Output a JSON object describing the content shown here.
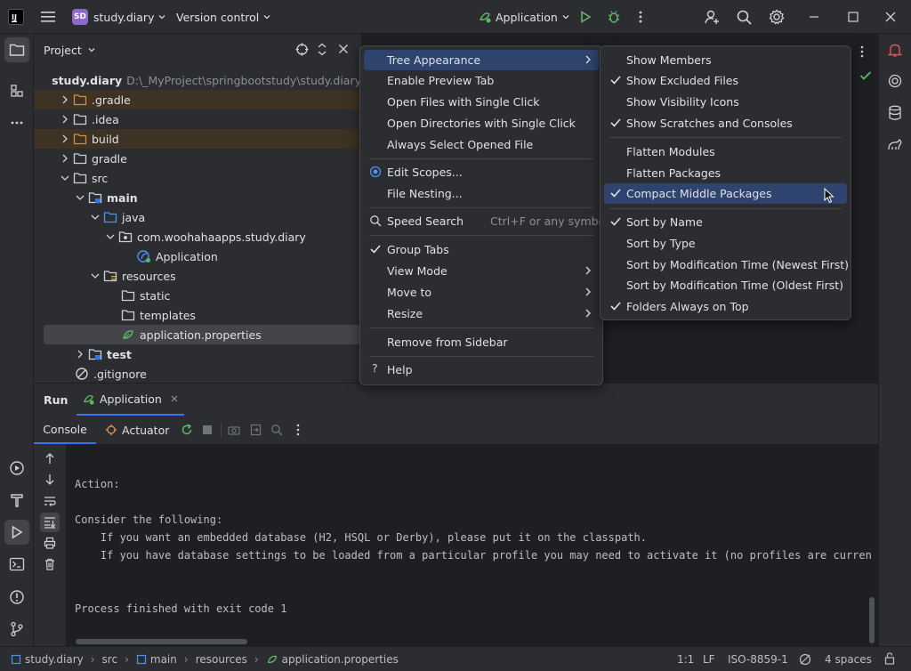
{
  "titlebar": {
    "project_badge": "SD",
    "project_name": "study.diary",
    "vcs_label": "Version control",
    "run_config": "Application",
    "icons": [
      "app-logo-icon",
      "hamburger-icon",
      "run-config-icon",
      "run-icon",
      "debug-icon",
      "more-icon",
      "add-user-icon",
      "search-icon",
      "settings-icon",
      "minimize-icon",
      "maximize-icon",
      "close-icon"
    ]
  },
  "project_panel": {
    "title": "Project",
    "tree": [
      {
        "label": "study.diary",
        "path": "D:\\_MyProject\\springbootstudy\\study.diary"
      },
      {
        "label": ".gradle"
      },
      {
        "label": ".idea"
      },
      {
        "label": "build"
      },
      {
        "label": "gradle"
      },
      {
        "label": "src"
      },
      {
        "label": "main"
      },
      {
        "label": "java"
      },
      {
        "label": "com.woohahaapps.study.diary"
      },
      {
        "label": "Application"
      },
      {
        "label": "resources"
      },
      {
        "label": "static"
      },
      {
        "label": "templates"
      },
      {
        "label": "application.properties"
      },
      {
        "label": "test"
      },
      {
        "label": ".gitignore"
      }
    ]
  },
  "options_menu": {
    "items": [
      {
        "label": "Tree Appearance"
      },
      {
        "label": "Enable Preview Tab"
      },
      {
        "label": "Open Files with Single Click"
      },
      {
        "label": "Open Directories with Single Click"
      },
      {
        "label": "Always Select Opened File"
      },
      {
        "label": "Edit Scopes..."
      },
      {
        "label": "File Nesting..."
      },
      {
        "label": "Speed Search",
        "shortcut": "Ctrl+F or any symbol"
      },
      {
        "label": "Group Tabs"
      },
      {
        "label": "View Mode"
      },
      {
        "label": "Move to"
      },
      {
        "label": "Resize"
      },
      {
        "label": "Remove from Sidebar"
      },
      {
        "label": "Help"
      }
    ]
  },
  "tree_appearance_menu": {
    "items": [
      {
        "label": "Show Members",
        "checked": false
      },
      {
        "label": "Show Excluded Files",
        "checked": true
      },
      {
        "label": "Show Visibility Icons",
        "checked": false
      },
      {
        "label": "Show Scratches and Consoles",
        "checked": true
      },
      {
        "label": "Flatten Modules",
        "checked": false
      },
      {
        "label": "Flatten Packages",
        "checked": false
      },
      {
        "label": "Compact Middle Packages",
        "checked": true
      },
      {
        "label": "Sort by Name",
        "checked": true
      },
      {
        "label": "Sort by Type",
        "checked": false
      },
      {
        "label": "Sort by Modification Time (Newest First)",
        "checked": false
      },
      {
        "label": "Sort by Modification Time (Oldest First)",
        "checked": false
      },
      {
        "label": "Folders Always on Top",
        "checked": true
      }
    ]
  },
  "run_panel": {
    "title": "Run",
    "tab": "Application",
    "console_tab": "Console",
    "actuator_tab": "Actuator",
    "lines": [
      "Action:",
      "Consider the following:",
      "    If you want an embedded database (H2, HSQL or Derby), please put it on the classpath.",
      "    If you have database settings to be loaded from a particular profile you may need to activate it (no profiles are curren",
      "Process finished with exit code 1"
    ]
  },
  "status_bar": {
    "breadcrumb": [
      "study.diary",
      "src",
      "main",
      "resources",
      "application.properties"
    ],
    "position": "1:1",
    "line_sep": "LF",
    "encoding": "ISO-8859-1",
    "indent": "4 spaces"
  },
  "colors": {
    "accent": "#3574f0",
    "highlight": "#2e436e",
    "excluded_bg": "#3d3223",
    "run_green": "#5fb865"
  }
}
